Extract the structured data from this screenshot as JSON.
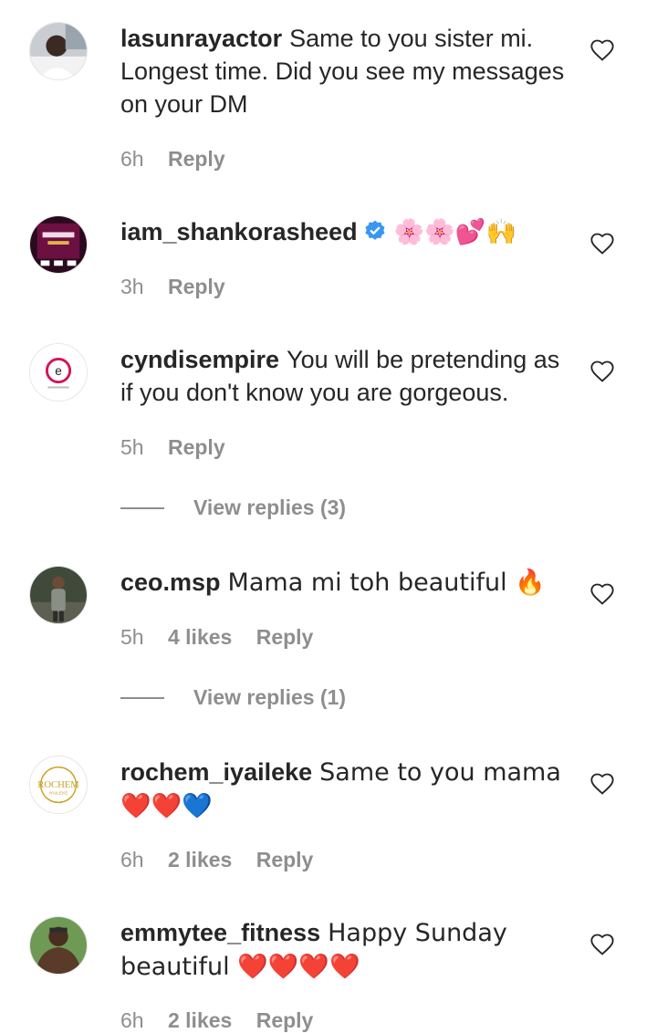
{
  "comments": [
    {
      "username": "lasunrayactor",
      "text": "Same to you sister mi. Longest time. Did you see my messages on your DM",
      "time": "6h",
      "likes": "",
      "reply": "Reply"
    },
    {
      "username": "iam_shankorasheed",
      "text": "🌸🌸💕🙌",
      "time": "3h",
      "likes": "",
      "reply": "Reply",
      "verified": true
    },
    {
      "username": "cyndisempire",
      "text": "You will be pretending as if you don't know you are gorgeous.",
      "time": "5h",
      "likes": "",
      "reply": "Reply",
      "view_replies": "View replies (3)"
    },
    {
      "username": "ceo.msp",
      "text": "Mama mi toh beautiful 🔥",
      "time": "5h",
      "likes": "4 likes",
      "reply": "Reply",
      "view_replies": "View replies (1)"
    },
    {
      "username": "rochem_iyaileke",
      "text": "Same to you mama ❤️❤️💙",
      "time": "6h",
      "likes": "2 likes",
      "reply": "Reply"
    },
    {
      "username": "emmytee_fitness",
      "text": "Happy Sunday beautiful ❤️❤️❤️❤️",
      "time": "6h",
      "likes": "2 likes",
      "reply": "Reply"
    }
  ],
  "icons": {
    "like": "heart-outline-icon",
    "verified": "verified-badge-icon"
  },
  "colors": {
    "text": "#262626",
    "secondary": "#8e8e8e",
    "verified_blue": "#3897f0"
  }
}
